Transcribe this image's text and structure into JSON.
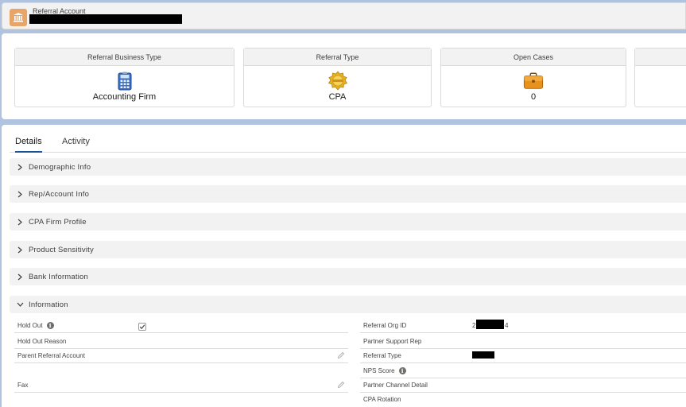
{
  "header": {
    "object_label": "Referral Account",
    "icon": "bank-icon"
  },
  "highlights": [
    {
      "title": "Referral Business Type",
      "value": "Accounting Firm",
      "icon": "calculator-icon"
    },
    {
      "title": "Referral Type",
      "value": "CPA",
      "icon": "award-seal-icon"
    },
    {
      "title": "Open Cases",
      "value": "0",
      "icon": "briefcase-icon"
    }
  ],
  "tabs": [
    {
      "label": "Details",
      "active": true
    },
    {
      "label": "Activity",
      "active": false
    }
  ],
  "sections": [
    {
      "label": "Demographic Info",
      "expanded": false
    },
    {
      "label": "Rep/Account Info",
      "expanded": false
    },
    {
      "label": "CPA Firm Profile",
      "expanded": false
    },
    {
      "label": "Product Sensitivity",
      "expanded": false
    },
    {
      "label": "Bank Information",
      "expanded": false
    },
    {
      "label": "Information",
      "expanded": true
    }
  ],
  "fields_left": [
    {
      "label": "Hold Out",
      "has_info": true,
      "checkbox_checked": true
    },
    {
      "label": "Hold Out Reason"
    },
    {
      "label": "Parent Referral Account",
      "editable": true
    },
    {
      "label": "Fax",
      "editable": true
    }
  ],
  "fields_right": [
    {
      "label": "Referral Org ID",
      "value_prefix": "2",
      "value_suffix": "4"
    },
    {
      "label": "Partner Support Rep"
    },
    {
      "label": "Referral Type"
    },
    {
      "label": "NPS Score",
      "has_info": true
    },
    {
      "label": "Partner Channel Detail"
    },
    {
      "label": "CPA Rotation"
    }
  ],
  "colors": {
    "background": "#b0c4df",
    "tab_active": "#1b5297",
    "object_icon": "#e8a567"
  }
}
